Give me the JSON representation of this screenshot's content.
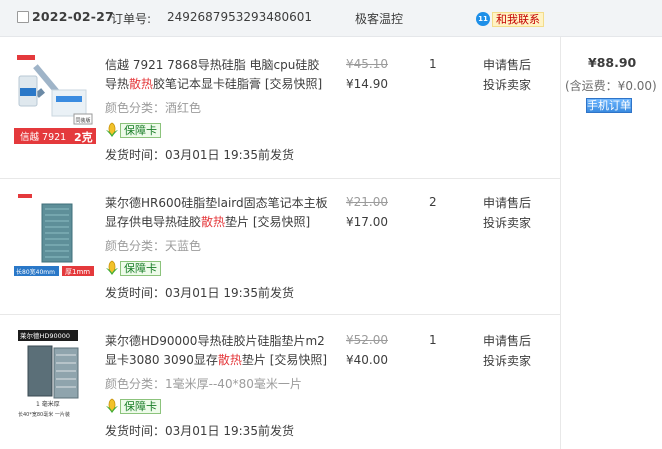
{
  "order": {
    "date": "2022-02-27",
    "order_label": "订单号:",
    "order_no": "2492687953293480601",
    "shop": "极客温控",
    "chat_label": "和我联系",
    "total": "¥88.90",
    "shipping": "(含运费：¥0.00)",
    "snapshot_btn": "手机订单"
  },
  "items": [
    {
      "title_a": "信越 7921 7868导热硅脂 电脑cpu硅胶导热",
      "title_hot": "散热",
      "title_b": "胶笔记本显卡硅脂膏 [交易快照]",
      "color_label": "颜色分类：",
      "color_value": "酒红色",
      "guarantee": "保障卡",
      "ship_label": "发货时间：",
      "ship_time": "03月01日 19:35前发货",
      "orig_price": "¥45.10",
      "price": "¥14.90",
      "qty": "1",
      "action1": "申请售后",
      "action2": "投诉卖家",
      "thumb_top": "信越 7921",
      "thumb_tag": "2克",
      "thumb_side": "同装版"
    },
    {
      "title_a": "莱尔德HR600硅脂垫laird固态笔记本主板显存供电导热硅胶",
      "title_hot": "散热",
      "title_b": "垫片 [交易快照]",
      "color_label": "颜色分类：",
      "color_value": "天蓝色",
      "guarantee": "保障卡",
      "ship_label": "发货时间：",
      "ship_time": "03月01日 19:35前发货",
      "orig_price": "¥21.00",
      "price": "¥17.00",
      "qty": "2",
      "action1": "申请售后",
      "action2": "投诉卖家",
      "thumb_dim": "长80宽40mm",
      "thumb_thick": "厚1mm"
    },
    {
      "title_a": "莱尔德HD90000导热硅胶片硅脂垫片m2显卡3080 3090显存",
      "title_hot": "散热",
      "title_b": "垫片 [交易快照]",
      "color_label": "颜色分类：",
      "color_value": "1毫米厚--40*80毫米一片",
      "guarantee": "保障卡",
      "ship_label": "发货时间：",
      "ship_time": "03月01日 19:35前发货",
      "orig_price": "¥52.00",
      "price": "¥40.00",
      "qty": "1",
      "action1": "申请售后",
      "action2": "投诉卖家",
      "thumb_brand": "莱尔德HD90000",
      "thumb_thick": "1 毫米厚",
      "thumb_dim": "长40*宽80毫米 一片装"
    }
  ],
  "colors": {
    "hot": "#e4393c",
    "muted": "#9c9c9c",
    "header_bg": "#f2f4f6",
    "link_blue": "#1e8fe8"
  }
}
